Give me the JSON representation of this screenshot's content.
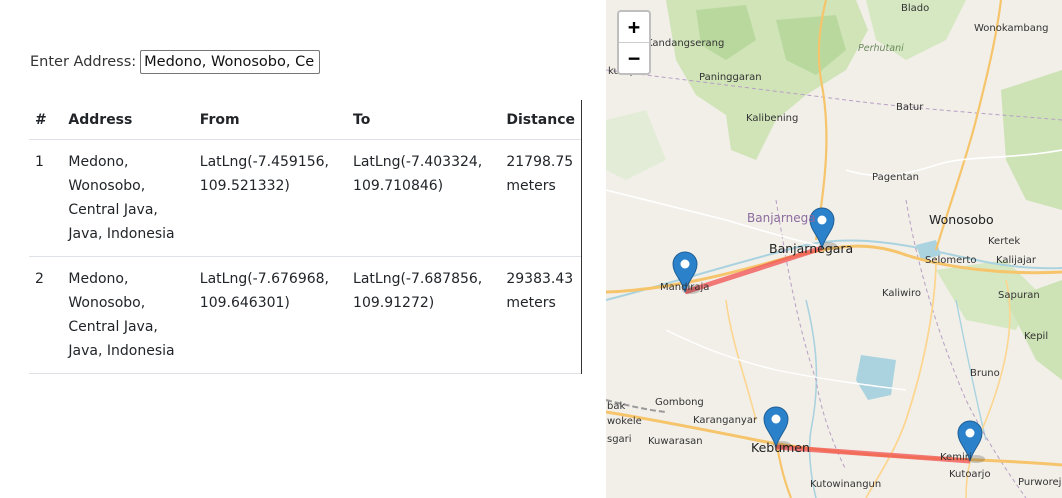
{
  "form": {
    "label": "Enter Address:",
    "value": "Medono, Wonosobo, Ce"
  },
  "table": {
    "headers": [
      "#",
      "Address",
      "From",
      "To",
      "Distance"
    ],
    "rows": [
      {
        "num": "1",
        "address": "Medono,\nWonosobo,\nCentral Java,\nJava, Indonesia",
        "from": "LatLng(-7.459156,\n109.521332)",
        "to": "LatLng(-7.403324,\n109.710846)",
        "distance": "21798.75\nmeters"
      },
      {
        "num": "2",
        "address": "Medono,\nWonosobo,\nCentral Java,\nJava, Indonesia",
        "from": "LatLng(-7.676968,\n109.646301)",
        "to": "LatLng(-7.687856,\n109.91272)",
        "distance": "29383.43\nmeters"
      }
    ]
  },
  "map": {
    "zoom_in": "+",
    "zoom_out": "−",
    "route_color": "#f05050",
    "marker_color": "#2b82cb",
    "labels": {
      "blado": "Blado",
      "wonokambang": "Wonokambang",
      "kandangserang": "Kandangserang",
      "perhutani": "Perhutani",
      "kumpul": "kumpul",
      "paninggaran": "Paninggaran",
      "batur": "Batur",
      "kalibening": "Kalibening",
      "pagentan": "Pagentan",
      "banjarnegara_region": "Banjarnega",
      "wonosobo": "Wonosobo",
      "kertek": "Kertek",
      "banjarnegara": "Banjarnegara",
      "selomerto": "Selomerto",
      "kalijajar": "Kalijajar",
      "mandiraja": "Mandiraja",
      "kaliwiro": "Kaliwiro",
      "sapuran": "Sapuran",
      "kepil": "Kepil",
      "bruno": "Bruno",
      "gombong": "Gombong",
      "bak": "bak",
      "wokele": "wokele",
      "karanganyar": "Karanganyar",
      "sgari": "sgari",
      "kuwarasan": "Kuwarasan",
      "kebumen": "Kebumen",
      "kemiri": "Kemiri",
      "kutoarjo": "Kutoarjo",
      "purworejo": "Purworejo",
      "kutowinangun": "Kutowinangun"
    }
  }
}
